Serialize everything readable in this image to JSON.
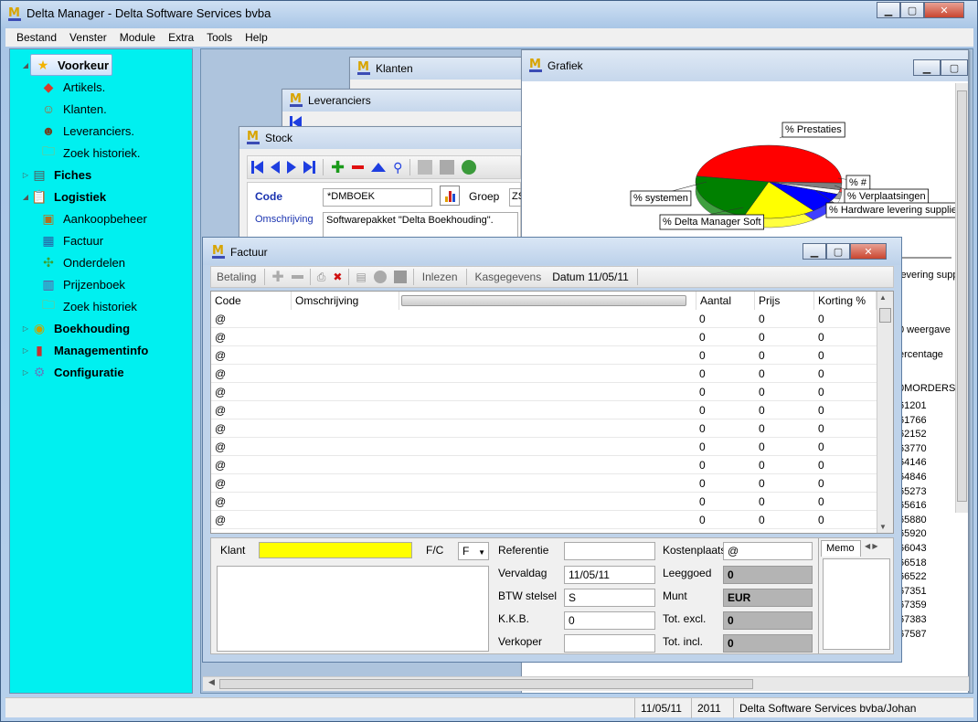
{
  "app": {
    "title": "Delta Manager - Delta Software Services bvba"
  },
  "menu": [
    "Bestand",
    "Venster",
    "Module",
    "Extra",
    "Tools",
    "Help"
  ],
  "sidebar": {
    "items": [
      {
        "label": "Voorkeur",
        "icon": "star-icon",
        "level": 0,
        "bold": true,
        "selected": true
      },
      {
        "label": "Artikels.",
        "icon": "shapes-icon",
        "level": 1
      },
      {
        "label": "Klanten.",
        "icon": "people-icon",
        "level": 1
      },
      {
        "label": "Leveranciers.",
        "icon": "person-icon",
        "level": 1
      },
      {
        "label": "Zoek historiek.",
        "icon": "folder-search-icon",
        "level": 1
      },
      {
        "label": "Fiches",
        "icon": "server-icon",
        "level": 0,
        "bold": true
      },
      {
        "label": "Logistiek",
        "icon": "clipboard-icon",
        "level": 0,
        "bold": true
      },
      {
        "label": "Aankoopbeheer",
        "icon": "purchase-icon",
        "level": 1
      },
      {
        "label": "Factuur",
        "icon": "invoice-icon",
        "level": 1
      },
      {
        "label": "Onderdelen",
        "icon": "puzzle-icon",
        "level": 1
      },
      {
        "label": "Prijzenboek",
        "icon": "book-icon",
        "level": 1
      },
      {
        "label": "Zoek historiek",
        "icon": "folder-search-icon",
        "level": 1
      },
      {
        "label": "Boekhouding",
        "icon": "coins-icon",
        "level": 0,
        "bold": true
      },
      {
        "label": "Managementinfo",
        "icon": "chart-icon",
        "level": 0,
        "bold": true
      },
      {
        "label": "Configuratie",
        "icon": "gear-icon",
        "level": 0,
        "bold": true
      }
    ]
  },
  "windows": {
    "klanten": {
      "title": "Klanten"
    },
    "leveranciers": {
      "title": "Leveranciers"
    },
    "stock": {
      "title": "Stock",
      "code_label": "Code",
      "code_value": "*DMBOEK",
      "groep_label": "Groep",
      "groep_value": "ZS",
      "omschrijving_label": "Omschrijving",
      "omschrijving_value": "Softwarepakket \"Delta Boekhouding\"."
    },
    "grafiek": {
      "title": "Grafiek",
      "right_texts": [
        "levering supp",
        "0 weergave",
        "ercentage",
        "0MORDERS/"
      ],
      "right_numbers": [
        "61201",
        "61766",
        "62152",
        "63770",
        "64146",
        "64846",
        "65273",
        "65616",
        "65880",
        "65920",
        "66043",
        "66518",
        "66522",
        "67351",
        "67359",
        "67383",
        "67587"
      ]
    }
  },
  "chart_data": {
    "type": "pie",
    "labels": [
      "% Prestaties",
      "% #",
      "% Verplaatsingen",
      "% Hardware levering supplies",
      "% Delta Manager Soft",
      "% systemen"
    ],
    "values": [
      48,
      3,
      2,
      9,
      16,
      22
    ],
    "colors": [
      "#ff0000",
      "#7f7f7f",
      "#ffffff",
      "#0000ff",
      "#ffff00",
      "#008000"
    ]
  },
  "factuur": {
    "title": "Factuur",
    "toolbar": {
      "betaling": "Betaling",
      "inlezen": "Inlezen",
      "kasgegevens": "Kasgegevens",
      "datum": "Datum 11/05/11"
    },
    "columns": [
      "Code",
      "Omschrijving",
      "Aantal",
      "Prijs",
      "Korting %"
    ],
    "rows": [
      [
        "@",
        "",
        "0",
        "0",
        "0"
      ],
      [
        "@",
        "",
        "0",
        "0",
        "0"
      ],
      [
        "@",
        "",
        "0",
        "0",
        "0"
      ],
      [
        "@",
        "",
        "0",
        "0",
        "0"
      ],
      [
        "@",
        "",
        "0",
        "0",
        "0"
      ],
      [
        "@",
        "",
        "0",
        "0",
        "0"
      ],
      [
        "@",
        "",
        "0",
        "0",
        "0"
      ],
      [
        "@",
        "",
        "0",
        "0",
        "0"
      ],
      [
        "@",
        "",
        "0",
        "0",
        "0"
      ],
      [
        "@",
        "",
        "0",
        "0",
        "0"
      ],
      [
        "@",
        "",
        "0",
        "0",
        "0"
      ],
      [
        "@",
        "",
        "0",
        "0",
        "0"
      ]
    ],
    "form": {
      "klant_label": "Klant",
      "fc_label": "F/C",
      "fc_value": "F",
      "referentie_label": "Referentie",
      "referentie_value": "",
      "vervaldag_label": "Vervaldag",
      "vervaldag_value": "11/05/11",
      "btw_label": "BTW stelsel",
      "btw_value": "S",
      "kkb_label": "K.K.B.",
      "kkb_value": "0",
      "verkoper_label": "Verkoper",
      "verkoper_value": "",
      "kostenplaats_label": "Kostenplaats",
      "kostenplaats_value": "@",
      "leeggoed_label": "Leeggoed",
      "leeggoed_value": "0",
      "munt_label": "Munt",
      "munt_value": "EUR",
      "totexcl_label": "Tot. excl.",
      "totexcl_value": "0",
      "totincl_label": "Tot. incl.",
      "totincl_value": "0",
      "memo_label": "Memo"
    }
  },
  "statusbar": {
    "date": "11/05/11",
    "year": "2011",
    "company_user": "Delta Software Services bvba/Johan"
  },
  "colors": {
    "sidebar_bg": "#00f0f0",
    "klant_field": "#ffff00"
  }
}
